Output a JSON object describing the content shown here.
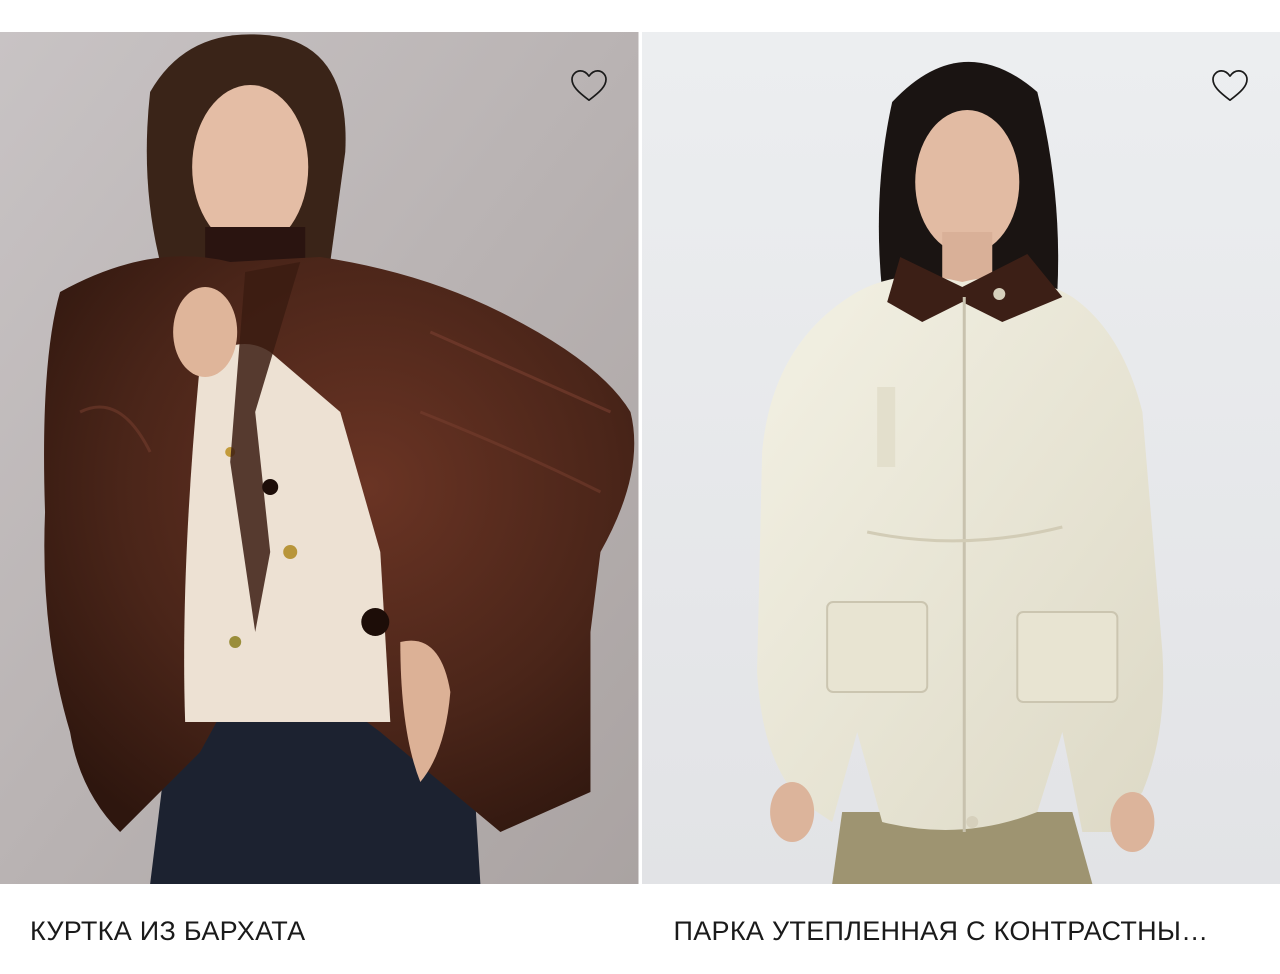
{
  "products": [
    {
      "title": "КУРТКА ИЗ БАРХАТА",
      "image_alt": "woman in brown velvet quilted jacket",
      "favorite_icon": "heart-outline-icon"
    },
    {
      "title": "ПАРКА УТЕПЛЕННАЯ С КОНТРАСТНЫ…",
      "image_alt": "woman in cream insulated parka with brown corduroy collar",
      "favorite_icon": "heart-outline-icon"
    }
  ],
  "colors": {
    "background": "#ffffff",
    "text": "#1a1a1a",
    "photo1_bg": "#bdb7b6",
    "photo2_bg": "#e7e8ea",
    "velvet_brown": "#4a2519",
    "cream": "#ece9da"
  }
}
